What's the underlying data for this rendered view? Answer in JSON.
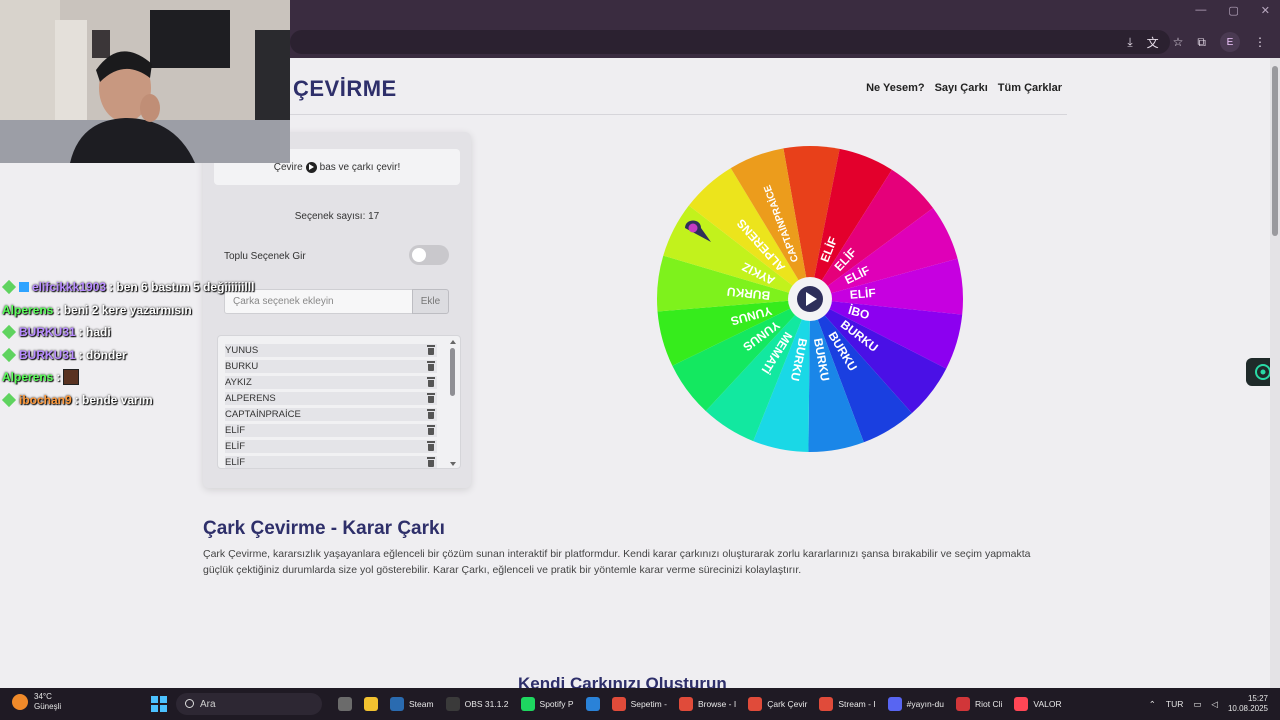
{
  "browser": {
    "window_controls": [
      "—",
      "▢",
      "✕"
    ],
    "profile_initial": "E"
  },
  "site": {
    "title": "K ÇEVİRME",
    "nav": [
      "Ne Yesem?",
      "Sayı Çarkı",
      "Tüm Çarklar"
    ]
  },
  "card": {
    "hint_before": "Çevire",
    "hint_after": "bas ve çarkı çevir!",
    "count_label": "Seçenek sayısı: 17",
    "bulk_label": "Toplu Seçenek Gir",
    "input_placeholder": "Çarka seçenek ekleyin",
    "add_button": "Ekle",
    "items": [
      "YUNUS",
      "BURKU",
      "AYKIZ",
      "ALPERENS",
      "CAPTAİNPRAİCE",
      "ELİF",
      "ELİF",
      "ELİF"
    ]
  },
  "wheel": {
    "labels": [
      "ELİF",
      "ELİF",
      "ELİF",
      "ELİF",
      "İBO",
      "BURKU",
      "BURKU",
      "BURKU",
      "BURKU",
      "MEMATİ",
      "YUNUS",
      "YUNUS",
      "BURKU",
      "AYKIZ",
      "ALPERENS",
      "CAPTAİNPRAİCE"
    ],
    "colors": [
      "#e8401a",
      "#e3002c",
      "#e5007a",
      "#df00b8",
      "#c600e0",
      "#8c00f0",
      "#4a10e6",
      "#1a3fe0",
      "#1a86e8",
      "#1ad8e6",
      "#12e8a0",
      "#14e860",
      "#36ec1c",
      "#7ef21c",
      "#c2f21c",
      "#ece41c",
      "#ec9c1c"
    ]
  },
  "article": {
    "title": "Çark Çevirme - Karar Çarkı",
    "body": "Çark Çevirme, kararsızlık yaşayanlara eğlenceli bir çözüm sunan interaktif bir platformdur. Kendi karar çarkınızı oluşturarak zorlu kararlarınızı şansa bırakabilir ve seçim yapmakta güçlük çektiğiniz durumlarda size yol gösterebilir. Karar Çarkı, eğlenceli ve pratik bir yöntemle karar verme sürecinizi kolaylaştırır.",
    "next_title": "Kendi Çarkınızı Oluşturun"
  },
  "chat": [
    {
      "user": "elifcikkk1903",
      "color": "#b88cff",
      "text": ": ben 6 bastım 5 değiiiiiilll"
    },
    {
      "user": "Alperens",
      "color": "#5cff5c",
      "text": ": beni 2 kere yazarmısın"
    },
    {
      "user": "BURKU31",
      "color": "#b88cff",
      "text": ": hadi"
    },
    {
      "user": "BURKU31",
      "color": "#b88cff",
      "text": ": dönder"
    },
    {
      "user": "Alperens",
      "color": "#5cff5c",
      "text": ":"
    },
    {
      "user": "ibochan9",
      "color": "#ff9a3c",
      "text": ": bende varım"
    }
  ],
  "taskbar": {
    "temperature": "34°C",
    "weather": "Güneşli",
    "search_placeholder": "Ara",
    "apps": [
      {
        "label": "",
        "color": "#6b6b6b"
      },
      {
        "label": "",
        "color": "#f2c230"
      },
      {
        "label": "Steam",
        "color": "#2a6bb0"
      },
      {
        "label": "OBS 31.1.2",
        "color": "#3a3a3a"
      },
      {
        "label": "Spotify P",
        "color": "#1ed760"
      },
      {
        "label": "",
        "color": "#2a82d8"
      },
      {
        "label": "Sepetim -",
        "color": "#e04b3a"
      },
      {
        "label": "Browse - I",
        "color": "#e04b3a"
      },
      {
        "label": "Çark Çevir",
        "color": "#e04b3a"
      },
      {
        "label": "Stream - I",
        "color": "#e04b3a"
      },
      {
        "label": "#yayın-du",
        "color": "#5865f2"
      },
      {
        "label": "Riot Cli",
        "color": "#d13639"
      },
      {
        "label": "VALOR",
        "color": "#ff4655"
      }
    ],
    "language": "TUR",
    "time": "15:27",
    "date": "10.08.2025"
  }
}
